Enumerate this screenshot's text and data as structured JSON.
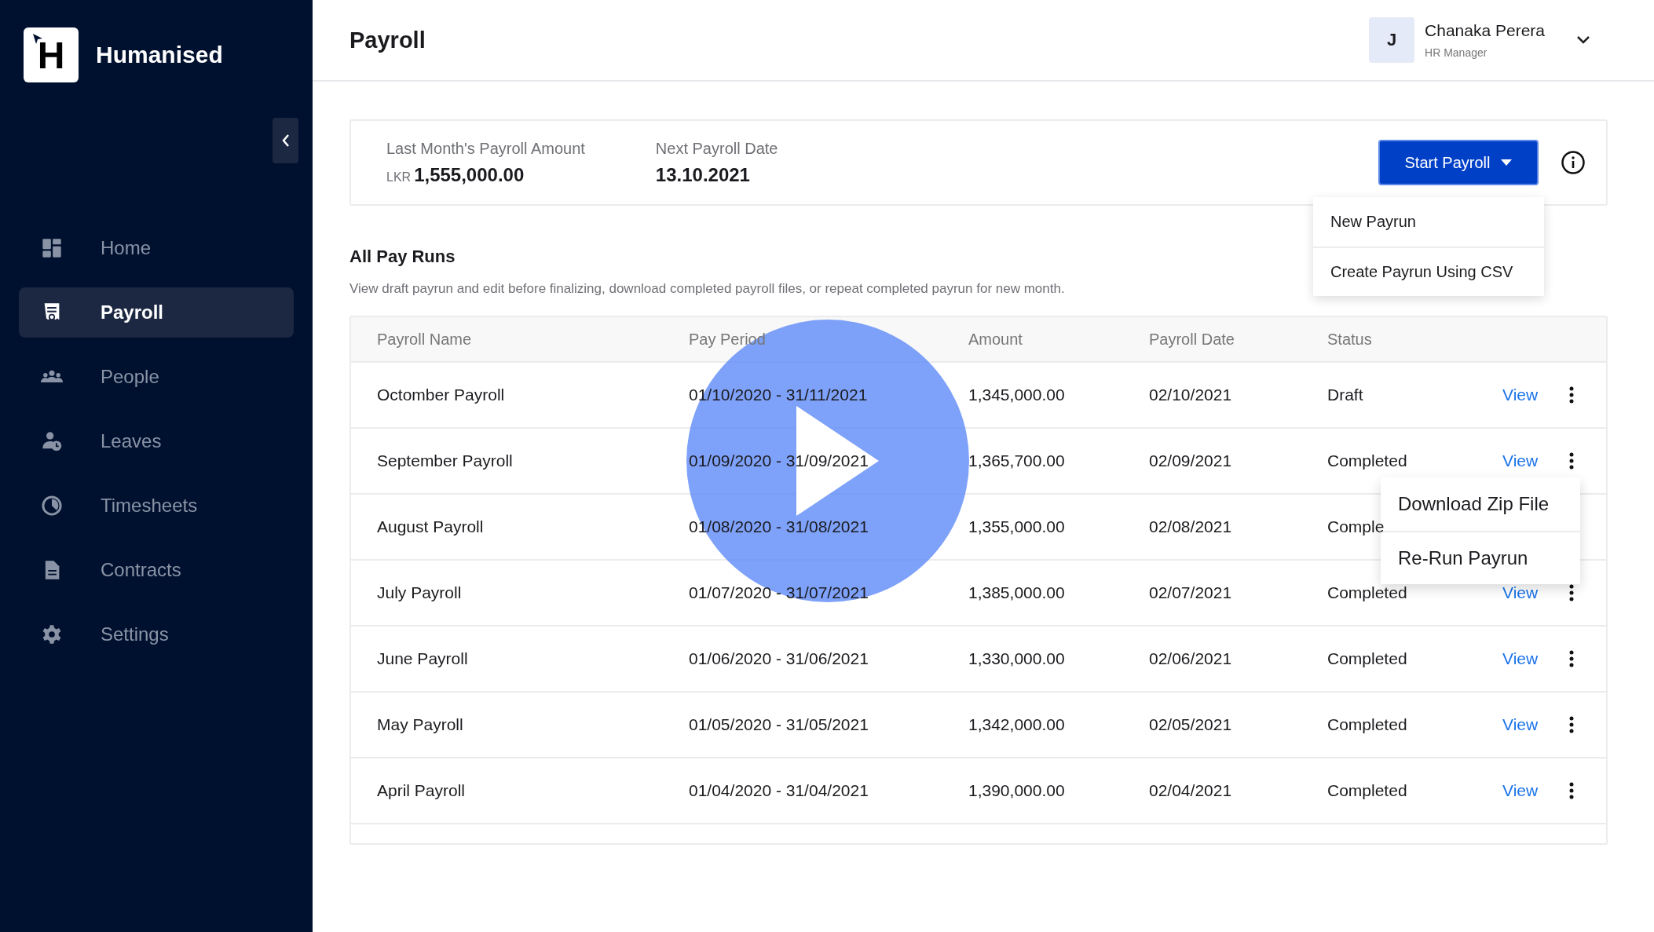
{
  "sidebar": {
    "logo_letter": "H",
    "brand": "Humanised",
    "items": [
      {
        "label": "Home",
        "selected": false
      },
      {
        "label": "Payroll",
        "selected": true
      },
      {
        "label": "People",
        "selected": false
      },
      {
        "label": "Leaves",
        "selected": false
      },
      {
        "label": "Timesheets",
        "selected": false
      },
      {
        "label": "Contracts",
        "selected": false
      },
      {
        "label": "Settings",
        "selected": false
      }
    ]
  },
  "header": {
    "title": "Payroll",
    "user": {
      "initial": "J",
      "name": "Chanaka Perera",
      "role": "HR Manager"
    }
  },
  "summary": {
    "last_amount_label": "Last Month's Payroll Amount",
    "currency": "LKR",
    "last_amount": "1,555,000.00",
    "next_date_label": "Next Payroll Date",
    "next_date": "13.10.2021",
    "start_button": "Start Payroll",
    "start_menu": [
      "New Payrun",
      "Create Payrun Using CSV"
    ]
  },
  "pay_runs": {
    "title": "All Pay Runs",
    "description": "View draft payrun and edit before finalizing, download completed payroll files, or repeat completed payrun for new month.",
    "columns": [
      "Payroll Name",
      "Pay Period",
      "Amount",
      "Payroll Date",
      "Status"
    ],
    "rows": [
      {
        "name": "Octomber Payroll",
        "period": "01/10/2020 - 31/11/2021",
        "amount": "1,345,000.00",
        "date": "02/10/2021",
        "status": "Draft",
        "action": "View"
      },
      {
        "name": "September Payroll",
        "period": "01/09/2020 - 31/09/2021",
        "amount": "1,365,700.00",
        "date": "02/09/2021",
        "status": "Completed",
        "action": "View"
      },
      {
        "name": "August Payroll",
        "period": "01/08/2020 - 31/08/2021",
        "amount": "1,355,000.00",
        "date": "02/08/2021",
        "status": "Comple"
      },
      {
        "name": "July Payroll",
        "period": "01/07/2020 - 31/07/2021",
        "amount": "1,385,000.00",
        "date": "02/07/2021",
        "status": "Completed",
        "action": "View"
      },
      {
        "name": "June Payroll",
        "period": "01/06/2020 - 31/06/2021",
        "amount": "1,330,000.00",
        "date": "02/06/2021",
        "status": "Completed",
        "action": "View"
      },
      {
        "name": "May Payroll",
        "period": "01/05/2020 - 31/05/2021",
        "amount": "1,342,000.00",
        "date": "02/05/2021",
        "status": "Completed",
        "action": "View"
      },
      {
        "name": "April Payroll",
        "period": "01/04/2020 - 31/04/2021",
        "amount": "1,390,000.00",
        "date": "02/04/2021",
        "status": "Completed",
        "action": "View"
      }
    ],
    "row_menu": [
      "Download Zip File",
      "Re-Run Payrun"
    ]
  }
}
